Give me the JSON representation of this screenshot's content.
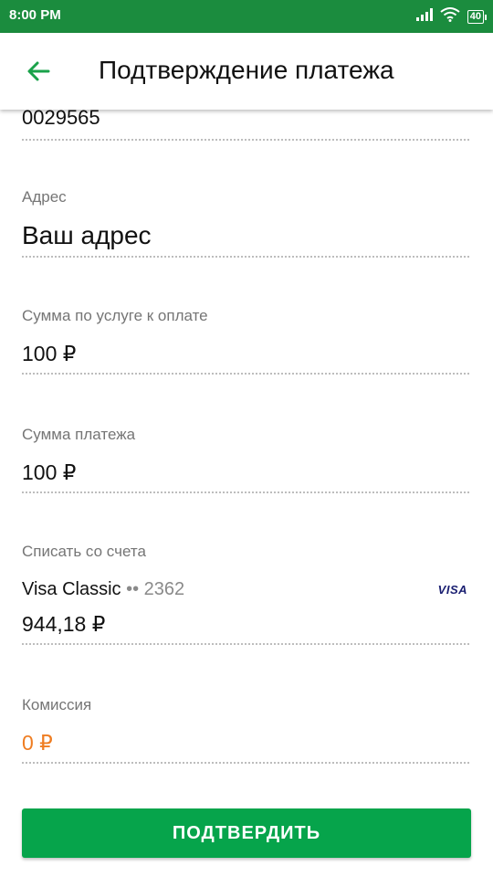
{
  "status_bar": {
    "time": "8:00 PM",
    "battery": "40"
  },
  "header": {
    "title": "Подтверждение платежа",
    "back_icon": "arrow-left-icon"
  },
  "fields": {
    "account": {
      "value": "0029565"
    },
    "address": {
      "label": "Адрес",
      "value": "Ваш адрес"
    },
    "service_amount": {
      "label": "Сумма по услуге к оплате",
      "value": "100 ₽"
    },
    "payment_amount": {
      "label": "Сумма платежа",
      "value": "100 ₽"
    },
    "debit_account": {
      "label": "Списать со счета",
      "card_name": "Visa Classic",
      "card_mask": "•• 2362",
      "card_logo": "VISA",
      "balance": "944,18 ₽"
    },
    "commission": {
      "label": "Комиссия",
      "value": "0 ₽"
    }
  },
  "actions": {
    "confirm_label": "ПОДТВЕРДИТЬ"
  },
  "colors": {
    "status_bar": "#1b8c3e",
    "accent": "#06a44b",
    "commission": "#ef7d22",
    "visa": "#1a1f71"
  }
}
